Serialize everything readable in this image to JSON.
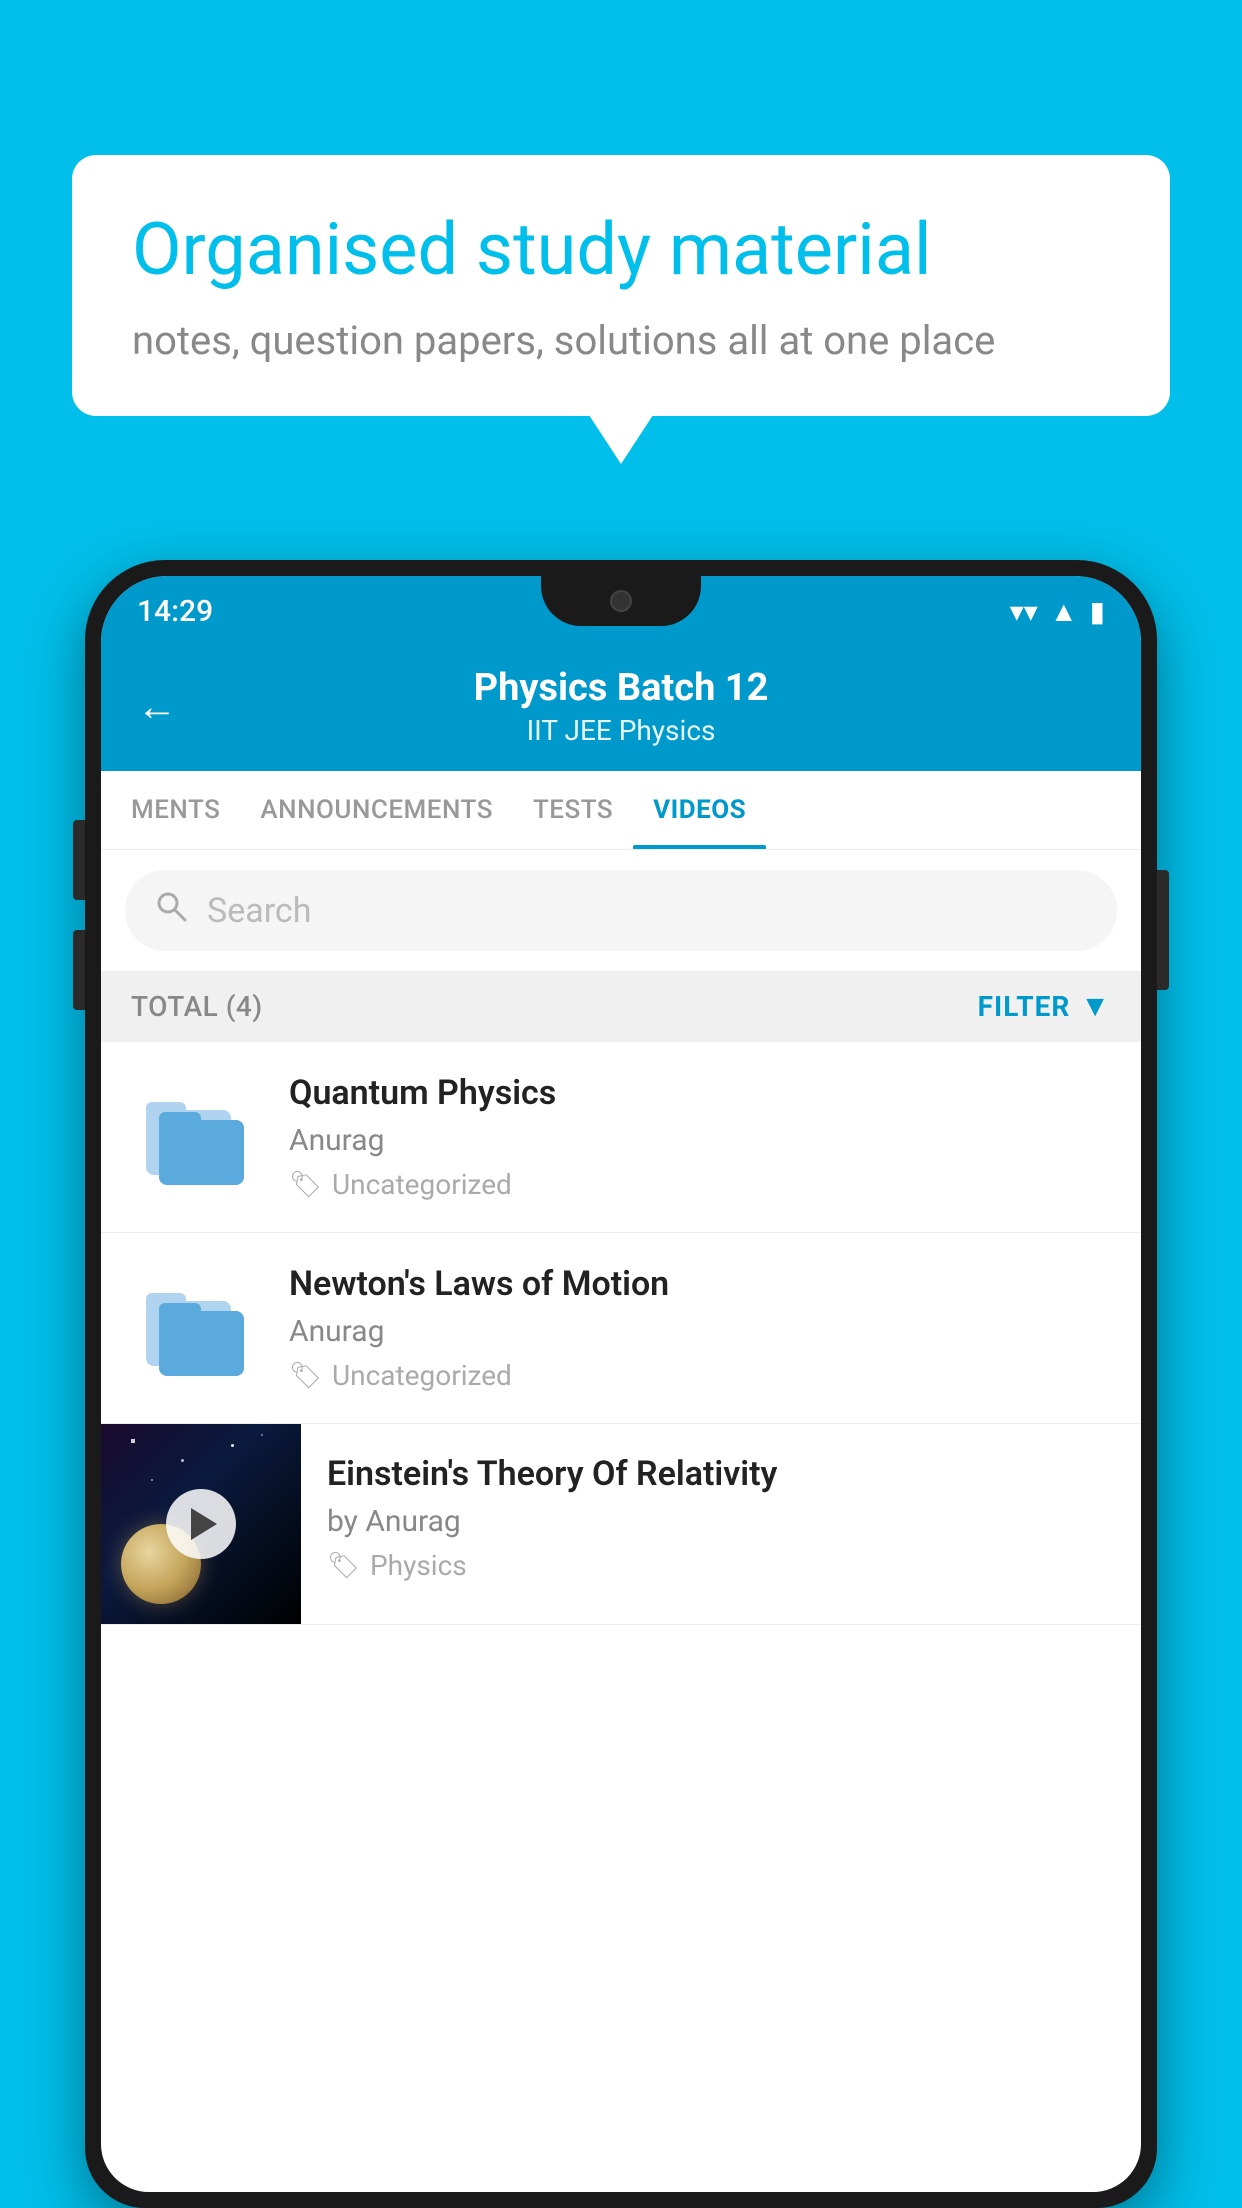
{
  "background_color": "#00BFEA",
  "speech_bubble": {
    "title": "Organised study material",
    "subtitle": "notes, question papers, solutions all at one place"
  },
  "status_bar": {
    "time": "14:29",
    "wifi_icon": "▾",
    "signal_icon": "▲",
    "battery_icon": "▮"
  },
  "header": {
    "title": "Physics Batch 12",
    "subtitle": "IIT JEE   Physics",
    "back_label": "←"
  },
  "tabs": [
    {
      "label": "MENTS",
      "active": false
    },
    {
      "label": "ANNOUNCEMENTS",
      "active": false
    },
    {
      "label": "TESTS",
      "active": false
    },
    {
      "label": "VIDEOS",
      "active": true
    }
  ],
  "search": {
    "placeholder": "Search"
  },
  "filter_row": {
    "total_label": "TOTAL (4)",
    "filter_label": "FILTER"
  },
  "videos": [
    {
      "id": 1,
      "title": "Quantum Physics",
      "author": "Anurag",
      "tag": "Uncategorized",
      "type": "folder"
    },
    {
      "id": 2,
      "title": "Newton's Laws of Motion",
      "author": "Anurag",
      "tag": "Uncategorized",
      "type": "folder"
    },
    {
      "id": 3,
      "title": "Einstein's Theory Of Relativity",
      "author": "by Anurag",
      "tag": "Physics",
      "type": "video"
    }
  ]
}
